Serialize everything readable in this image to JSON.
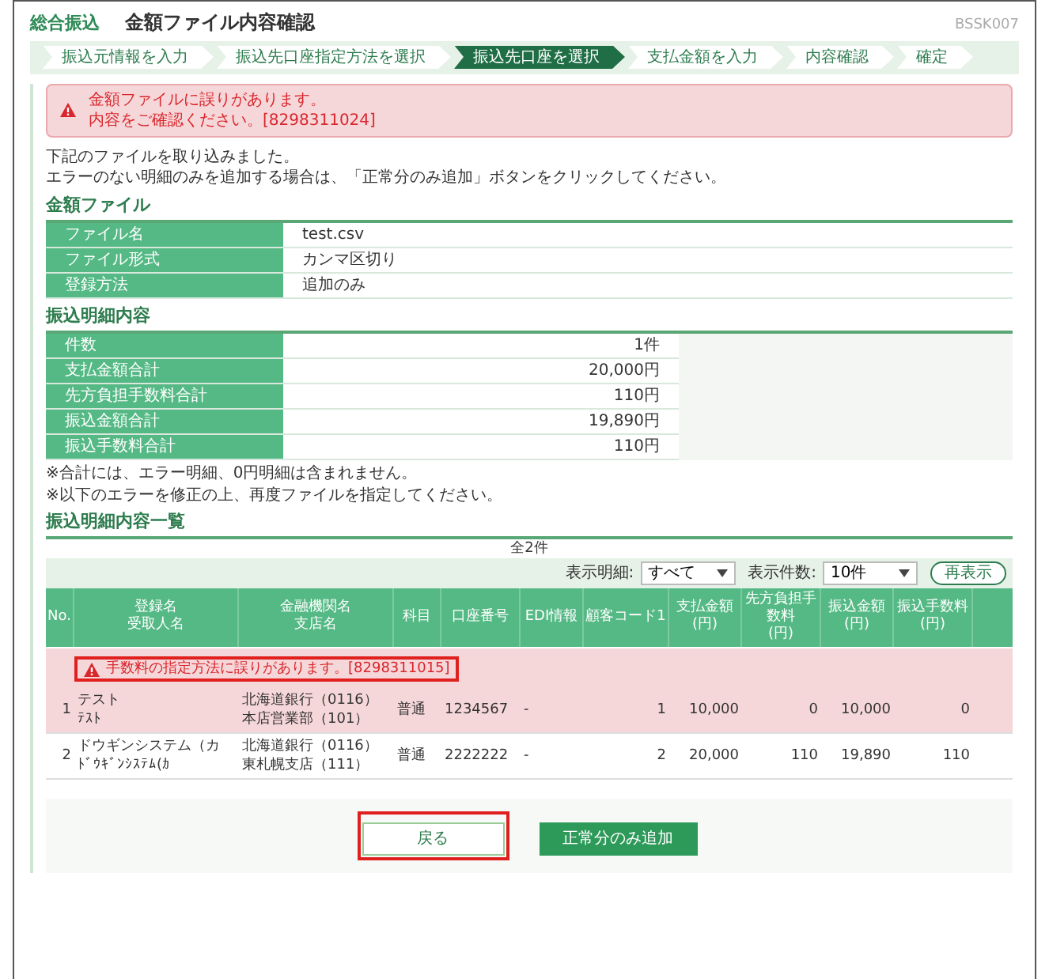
{
  "header": {
    "category": "総合振込",
    "title": "金額ファイル内容確認",
    "screen_id": "BSSK007"
  },
  "steps": [
    {
      "label": "振込元情報を入力",
      "selected": false
    },
    {
      "label": "振込先口座指定方法を選択",
      "selected": false
    },
    {
      "label": "振込先口座を選択",
      "selected": true
    },
    {
      "label": "支払金額を入力",
      "selected": false
    },
    {
      "label": "内容確認",
      "selected": false
    },
    {
      "label": "確定",
      "selected": false
    }
  ],
  "error_alert": {
    "lines": [
      "金額ファイルに誤りがあります。",
      "内容をご確認ください。[8298311024]"
    ]
  },
  "intro": [
    "下記のファイルを取り込みました。",
    "エラーのない明細のみを追加する場合は、「正常分のみ追加」ボタンをクリックしてください。"
  ],
  "file_section": {
    "title": "金額ファイル",
    "rows": [
      {
        "label": "ファイル名",
        "value": "test.csv"
      },
      {
        "label": "ファイル形式",
        "value": "カンマ区切り"
      },
      {
        "label": "登録方法",
        "value": "追加のみ"
      }
    ]
  },
  "summary_section": {
    "title": "振込明細内容",
    "rows": [
      {
        "label": "件数",
        "value": "1件"
      },
      {
        "label": "支払金額合計",
        "value": "20,000円"
      },
      {
        "label": "先方負担手数料合計",
        "value": "110円"
      },
      {
        "label": "振込金額合計",
        "value": "19,890円"
      },
      {
        "label": "振込手数料合計",
        "value": "110円"
      }
    ]
  },
  "notes": [
    "※合計には、エラー明細、0円明細は含まれません。",
    "※以下のエラーを修正の上、再度ファイルを指定してください。"
  ],
  "list_section": {
    "title": "振込明細内容一覧",
    "count": "全2件",
    "filters": [
      {
        "label": "表示明細:",
        "value": "すべて"
      },
      {
        "label": "表示件数:",
        "value": "10件"
      }
    ],
    "refresh_button": "再表示",
    "columns": [
      {
        "lines": [
          "No."
        ]
      },
      {
        "lines": [
          "登録名",
          "受取人名"
        ]
      },
      {
        "lines": [
          "金融機関名",
          "支店名"
        ]
      },
      {
        "lines": [
          "科目"
        ]
      },
      {
        "lines": [
          "口座番号"
        ]
      },
      {
        "lines": [
          "EDI情報"
        ]
      },
      {
        "lines": [
          "顧客コード1"
        ]
      },
      {
        "lines": [
          "支払金額",
          "(円)"
        ]
      },
      {
        "lines": [
          "先方負担手数料",
          "(円)"
        ]
      },
      {
        "lines": [
          "振込金額",
          "(円)"
        ]
      },
      {
        "lines": [
          "振込手数料",
          "(円)"
        ]
      }
    ],
    "rows": [
      {
        "error": true,
        "message": {
          "text": "手数料の指定方法に誤りがあります。[8298311015]",
          "highlighted": true
        },
        "cells": [
          [
            "1"
          ],
          [
            "テスト",
            "ﾃｽﾄ"
          ],
          [
            "北海道銀行（0116）",
            "本店営業部（101）"
          ],
          [
            "普通"
          ],
          [
            "1234567"
          ],
          [
            "-"
          ],
          [
            "1"
          ],
          [
            "10,000"
          ],
          [
            "0"
          ],
          [
            "10,000"
          ],
          [
            "0"
          ]
        ]
      },
      {
        "error": false,
        "cells": [
          [
            "2"
          ],
          [
            "ドウギンシステム（カ",
            "ﾄﾞｳｷﾞﾝｼｽﾃﾑ(ｶ"
          ],
          [
            "北海道銀行（0116）",
            "東札幌支店（111）"
          ],
          [
            "普通"
          ],
          [
            "2222222"
          ],
          [
            "-"
          ],
          [
            "2"
          ],
          [
            "20,000"
          ],
          [
            "110"
          ],
          [
            "19,890"
          ],
          [
            "110"
          ]
        ]
      }
    ]
  },
  "buttons": [
    {
      "label": "戻る",
      "kind": "secondary",
      "highlighted": true
    },
    {
      "label": "正常分のみ追加",
      "kind": "primary",
      "highlighted": false
    }
  ]
}
